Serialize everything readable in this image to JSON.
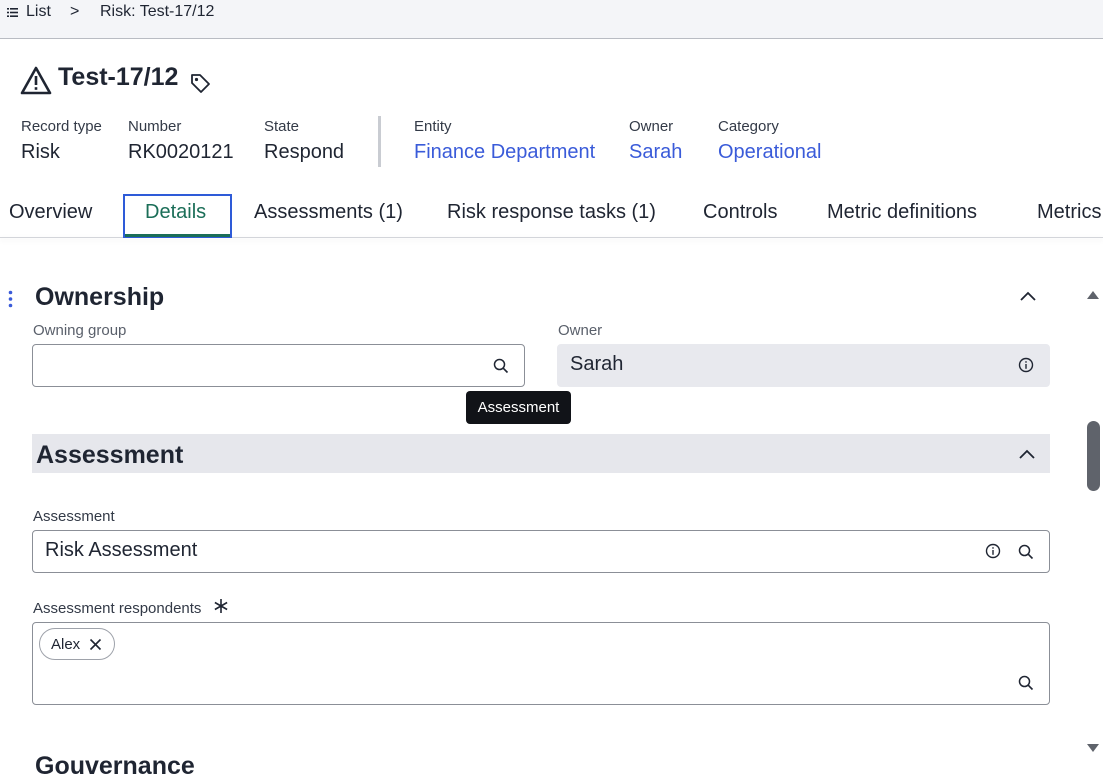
{
  "breadcrumb": {
    "list_label": "List",
    "separator": ">",
    "current": "Risk: Test-17/12"
  },
  "header": {
    "title": "Test-17/12",
    "icons": [
      "warning-icon",
      "tag-icon"
    ]
  },
  "meta": [
    {
      "label": "Record type",
      "value": "Risk",
      "link": false
    },
    {
      "label": "Number",
      "value": "RK0020121",
      "link": false
    },
    {
      "label": "State",
      "value": "Respond",
      "link": false
    },
    {
      "label": "Entity",
      "value": "Finance Department",
      "link": true
    },
    {
      "label": "Owner",
      "value": "Sarah",
      "link": true
    },
    {
      "label": "Category",
      "value": "Operational",
      "link": true
    }
  ],
  "tabs": [
    {
      "label": "Overview",
      "active": false
    },
    {
      "label": "Details",
      "active": true
    },
    {
      "label": "Assessments (1)",
      "active": false
    },
    {
      "label": "Risk response tasks (1)",
      "active": false
    },
    {
      "label": "Controls",
      "active": false
    },
    {
      "label": "Metric definitions",
      "active": false
    },
    {
      "label": "Metrics",
      "active": false
    }
  ],
  "ownership": {
    "title": "Ownership",
    "owning_group_label": "Owning group",
    "owning_group_value": "",
    "owner_label": "Owner",
    "owner_value": "Sarah"
  },
  "tooltip": "Assessment",
  "assessment": {
    "title": "Assessment",
    "field_label": "Assessment",
    "field_value": "Risk Assessment",
    "respondents_label": "Assessment respondents",
    "respondents": [
      "Alex"
    ]
  },
  "next_section_partial": "Gouvernance",
  "colors": {
    "link": "#3a5bd9",
    "active_tab": "#1b6e58",
    "focus_ring": "#2e5bd8",
    "section_band": "#e6e7ec"
  }
}
